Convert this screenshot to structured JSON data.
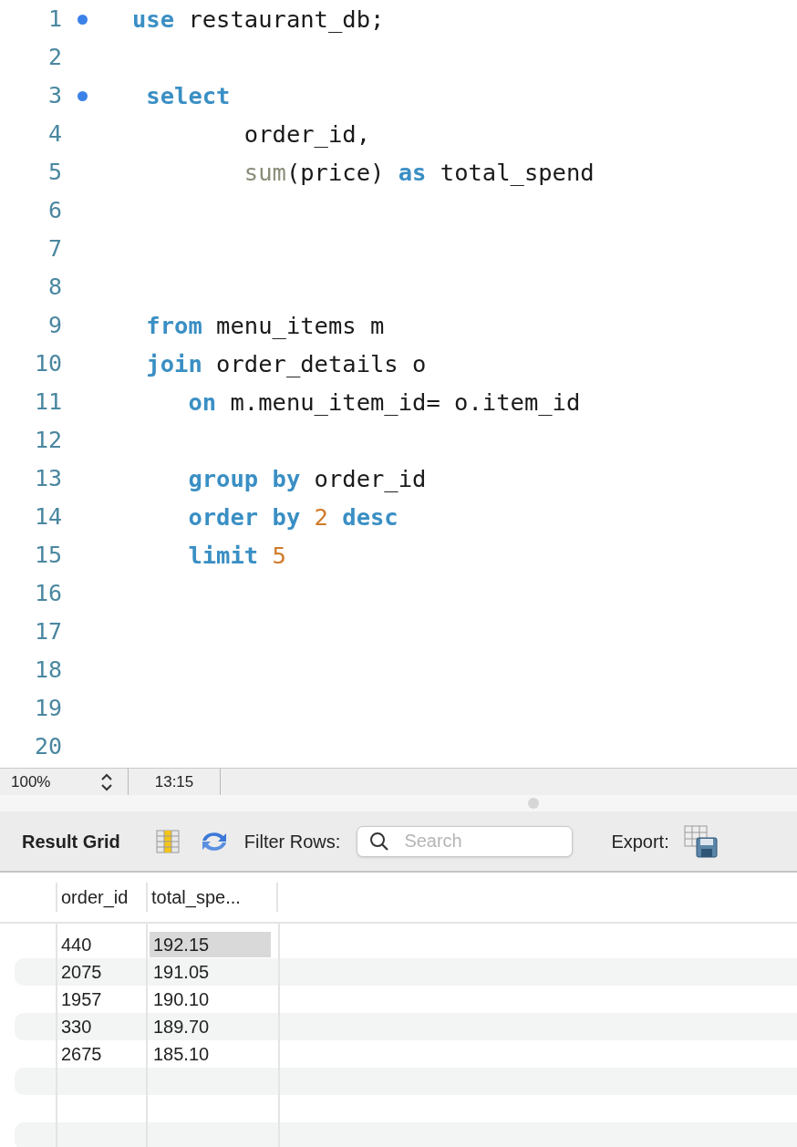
{
  "editor": {
    "lines": [
      {
        "number": "1",
        "marker": true,
        "tokens": [
          {
            "text": "use",
            "kind": "keyword"
          },
          {
            "text": " restaurant_db;",
            "kind": "plain"
          }
        ]
      },
      {
        "number": "2",
        "marker": false
      },
      {
        "number": "3",
        "marker": true,
        "tokens": [
          {
            "text": " select",
            "kind": "keyword"
          }
        ]
      },
      {
        "number": "4",
        "marker": false,
        "tokens": [
          {
            "text": "        order_id,",
            "kind": "plain"
          }
        ]
      },
      {
        "number": "5",
        "marker": false,
        "tokens": [
          {
            "text": "        sum",
            "kind": "function"
          },
          {
            "text": "(price) ",
            "kind": "plain"
          },
          {
            "text": "as",
            "kind": "keyword"
          },
          {
            "text": " total_spend",
            "kind": "plain"
          }
        ]
      },
      {
        "number": "6",
        "marker": false
      },
      {
        "number": "7",
        "marker": false
      },
      {
        "number": "8",
        "marker": false
      },
      {
        "number": "9",
        "marker": false,
        "tokens": [
          {
            "text": " from",
            "kind": "keyword"
          },
          {
            "text": " menu_items m",
            "kind": "plain"
          }
        ]
      },
      {
        "number": "10",
        "marker": false,
        "tokens": [
          {
            "text": " join",
            "kind": "keyword"
          },
          {
            "text": " order_details o",
            "kind": "plain"
          }
        ]
      },
      {
        "number": "11",
        "marker": false,
        "tokens": [
          {
            "text": "    on",
            "kind": "keyword"
          },
          {
            "text": " m.menu_item_id= o.item_id",
            "kind": "plain"
          }
        ]
      },
      {
        "number": "12",
        "marker": false
      },
      {
        "number": "13",
        "marker": false,
        "tokens": [
          {
            "text": "    group by",
            "kind": "keyword"
          },
          {
            "text": " order_id",
            "kind": "plain"
          }
        ]
      },
      {
        "number": "14",
        "marker": false,
        "tokens": [
          {
            "text": "    order by",
            "kind": "keyword"
          },
          {
            "text": " 2",
            "kind": "number"
          },
          {
            "text": " desc",
            "kind": "keyword"
          }
        ]
      },
      {
        "number": "15",
        "marker": false,
        "tokens": [
          {
            "text": "    limit",
            "kind": "keyword"
          },
          {
            "text": " 5",
            "kind": "number"
          }
        ]
      },
      {
        "number": "16",
        "marker": false
      },
      {
        "number": "17",
        "marker": false
      },
      {
        "number": "18",
        "marker": false
      },
      {
        "number": "19",
        "marker": false
      },
      {
        "number": "20",
        "marker": false
      }
    ]
  },
  "status_bar": {
    "zoom": "100%",
    "position": "13:15"
  },
  "result_toolbar": {
    "title": "Result Grid",
    "filter_label": "Filter Rows:",
    "search": {
      "placeholder": "Search"
    },
    "export_label": "Export:"
  },
  "table": {
    "columns": [
      "order_id",
      "total_spe..."
    ],
    "rows": [
      {
        "cells": [
          {
            "text": "440",
            "selected": false
          },
          {
            "text": "192.15",
            "selected": true
          }
        ]
      },
      {
        "cells": [
          {
            "text": "2075",
            "selected": false
          },
          {
            "text": "191.05",
            "selected": false
          }
        ]
      },
      {
        "cells": [
          {
            "text": "1957",
            "selected": false
          },
          {
            "text": "190.10",
            "selected": false
          }
        ]
      },
      {
        "cells": [
          {
            "text": "330",
            "selected": false
          },
          {
            "text": "189.70",
            "selected": false
          }
        ]
      },
      {
        "cells": [
          {
            "text": "2675",
            "selected": false
          },
          {
            "text": "185.10",
            "selected": false
          }
        ]
      }
    ]
  }
}
